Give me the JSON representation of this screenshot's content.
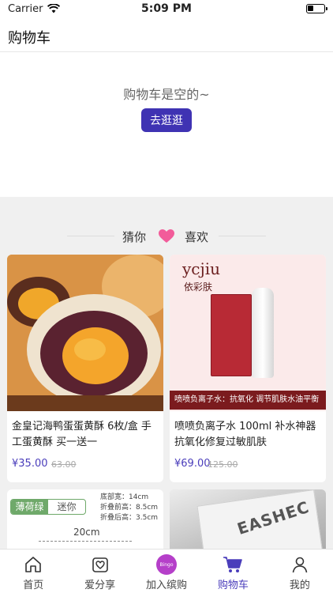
{
  "status_bar": {
    "carrier": "Carrier",
    "time": "5:09 PM"
  },
  "nav": {
    "title": "购物车"
  },
  "cart": {
    "empty_text": "购物车是空的~",
    "go_button": "去逛逛"
  },
  "recommend": {
    "left_text": "猜你",
    "right_text": "喜欢"
  },
  "products": [
    {
      "title": "金皇记海鸭蛋蛋黄酥 6枚/盒 手工蛋黄酥 买一送一",
      "price": "¥35.00",
      "old_price": "63.00"
    },
    {
      "title": "喷喷负离子水 100ml 补水神器抗氧化修复过敏肌肤",
      "price": "¥69.00",
      "old_price": "125.00",
      "brand_logo": "ycjiu",
      "brand_name": "依彩肤",
      "banner": "喷喷负离子水：抗氧化 调节肌肤水油平衡"
    },
    {
      "tag_active": "薄荷绿",
      "tag_inactive": "迷你",
      "spec_lines": [
        "底部宽：14cm",
        "折叠前高：8.5cm",
        "折叠后高：3.5cm"
      ],
      "width_label": "20cm"
    },
    {
      "brand_text": "EASHEC"
    }
  ],
  "tab_bar": {
    "items": [
      {
        "label": "首页"
      },
      {
        "label": "爱分享"
      },
      {
        "label": "加入缤购",
        "badge": "Bingo"
      },
      {
        "label": "购物车"
      },
      {
        "label": "我的"
      }
    ]
  },
  "colors": {
    "accent": "#4a3dbb",
    "button": "#3f33b3",
    "heart": "#f25c9a",
    "background_gray": "#f0f0f0"
  }
}
